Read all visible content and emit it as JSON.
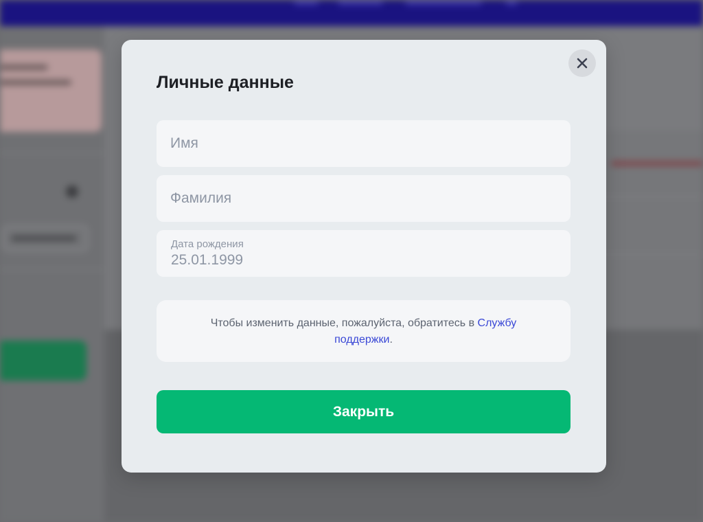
{
  "modal": {
    "title": "Личные данные",
    "close_icon": "close-icon",
    "fields": {
      "first_name": {
        "placeholder": "Имя",
        "value": ""
      },
      "last_name": {
        "placeholder": "Фамилия",
        "value": ""
      },
      "birth_date": {
        "label": "Дата рождения",
        "value": "25.01.1999"
      }
    },
    "info": {
      "text_before": "Чтобы изменить данные, пожалуйста, обратитесь в ",
      "link_text": "Службу поддержки",
      "text_after": "."
    },
    "close_button_label": "Закрыть"
  },
  "colors": {
    "accent_green": "#05b874",
    "link_blue": "#3a48d6",
    "top_bar": "#1a1380",
    "modal_bg": "#e8ecef"
  }
}
